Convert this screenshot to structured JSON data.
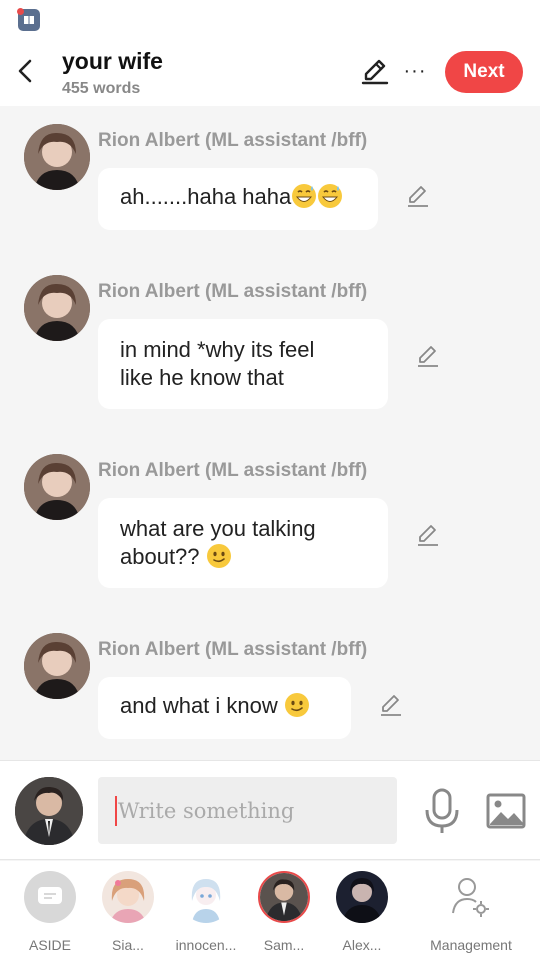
{
  "header": {
    "title": "your wife",
    "word_count": "455 words",
    "next_label": "Next",
    "more_label": "···"
  },
  "messages": [
    {
      "sender": "Rion Albert  (ML assistant /bff)",
      "text": "ah.......haha haha",
      "emoji": [
        "grinning-sweat-emoji",
        "grinning-sweat-emoji"
      ]
    },
    {
      "sender": "Rion Albert  (ML assistant /bff)",
      "line1": "in mind *why its feel",
      "line2": "like he know that"
    },
    {
      "sender": "Rion Albert  (ML assistant /bff)",
      "line1": "what are you talking",
      "line2": "about??",
      "emoji": [
        "smiling-emoji"
      ]
    },
    {
      "sender": "Rion Albert  (ML assistant /bff)",
      "text": "and what i know",
      "emoji": [
        "smiling-emoji"
      ]
    }
  ],
  "composer": {
    "placeholder": "Write something"
  },
  "cast_bar": [
    {
      "label": "ASIDE",
      "icon": "chat-bubble-icon"
    },
    {
      "label": "Sia..."
    },
    {
      "label": "innocen..."
    },
    {
      "label": "Sam...",
      "selected": true
    },
    {
      "label": "Alex..."
    },
    {
      "label": "Management",
      "icon": "user-gear-icon"
    }
  ],
  "colors": {
    "accent": "#f04646",
    "background": "#f5f5f5",
    "muted_text": "#999999"
  }
}
